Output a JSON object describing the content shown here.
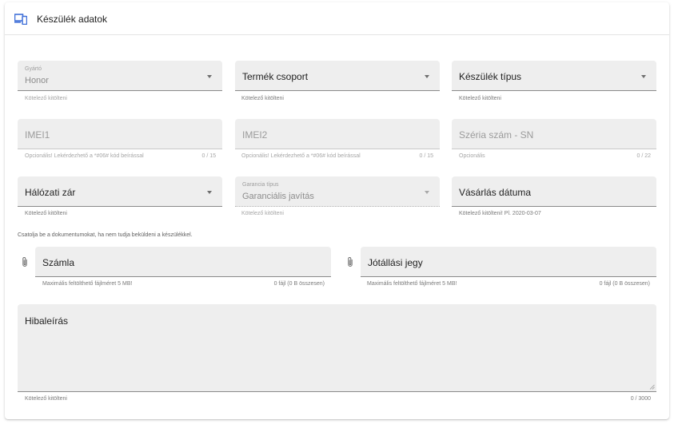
{
  "header": {
    "title": "Készülék adatok",
    "icon": "devices-icon"
  },
  "row1": {
    "manufacturer": {
      "label": "Gyártó",
      "value": "Honor",
      "hint": "Kötelező kitölteni"
    },
    "product_group": {
      "label": "Termék csoport",
      "hint": "Kötelező kitölteni"
    },
    "device_type": {
      "label": "Készülék típus",
      "hint": "Kötelező kitölteni"
    }
  },
  "row2": {
    "imei1": {
      "placeholder": "IMEI1",
      "hint": "Opcionális! Lekérdezhető a *#06# kód beírással",
      "counter": "0 / 15"
    },
    "imei2": {
      "placeholder": "IMEI2",
      "hint": "Opcionális! Lekérdezhető a *#06# kód beírással",
      "counter": "0 / 15"
    },
    "serial": {
      "placeholder": "Széria szám - SN",
      "hint": "Opcionális",
      "counter": "0 / 22"
    }
  },
  "row3": {
    "network_lock": {
      "label": "Hálózati zár",
      "hint": "Kötelező kitölteni"
    },
    "warranty_type": {
      "label": "Garancia típus",
      "value": "Garanciális javítás",
      "hint": "Kötelező kitölteni"
    },
    "purchase_date": {
      "label": "Vásárlás dátuma",
      "hint": "Kötelező kitölteni! Pl. 2020-03-07"
    }
  },
  "attachments": {
    "note": "Csatolja be a dokumentumokat, ha nem tudja beküldeni a készülékkel.",
    "invoice": {
      "label": "Számla",
      "hint": "Maximális feltölthető fájlméret 5 MB!",
      "counter": "0 fájl (0 B összesen)"
    },
    "warranty_card": {
      "label": "Jótállási jegy",
      "hint": "Maximális feltölthető fájlméret 5 MB!",
      "counter": "0 fájl (0 B összesen)"
    }
  },
  "description": {
    "label": "Hibaleírás",
    "hint": "Kötelező kitölteni",
    "counter": "0 / 3000"
  },
  "colors": {
    "accent": "#3f6fd8",
    "field_bg": "#eeeeee"
  }
}
